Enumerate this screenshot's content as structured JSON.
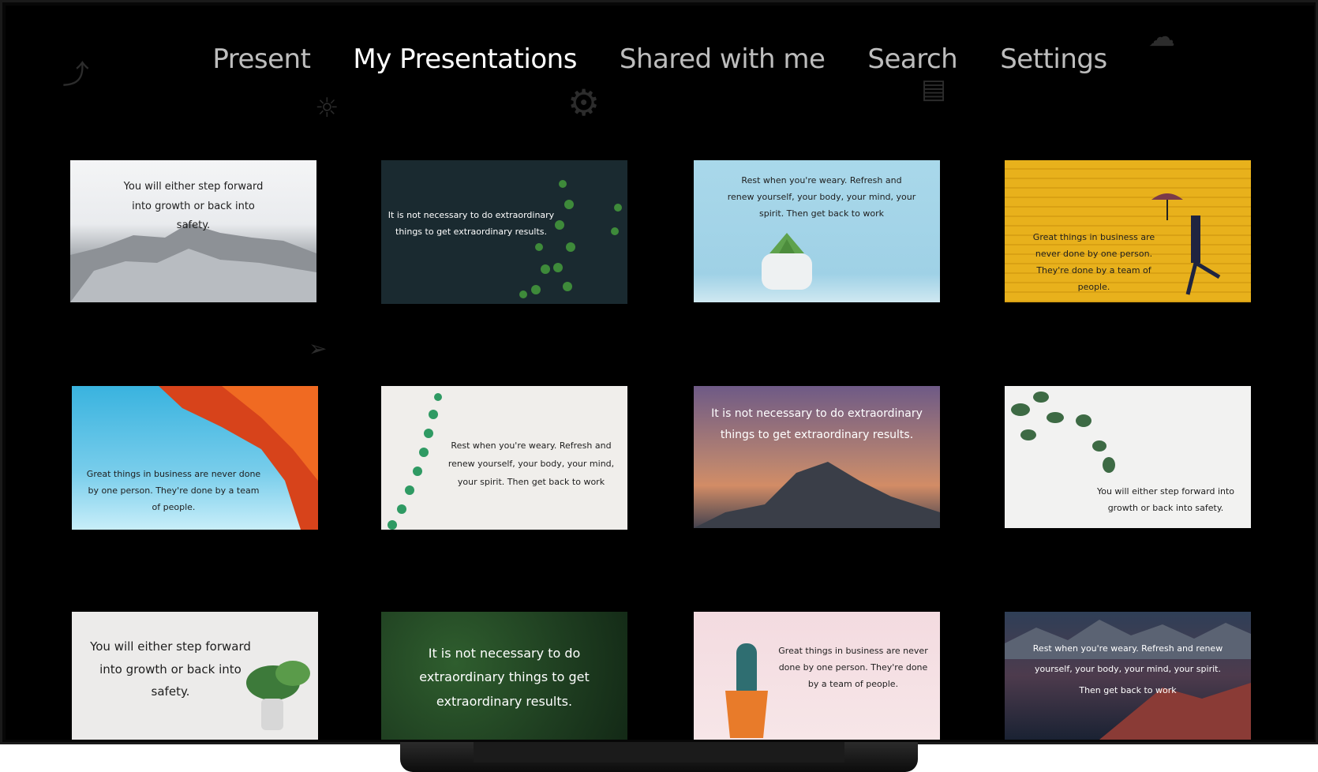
{
  "nav": {
    "tabs": [
      {
        "label": "Present"
      },
      {
        "label": "My Presentations",
        "active": true
      },
      {
        "label": "Shared with me"
      },
      {
        "label": "Search"
      },
      {
        "label": "Settings"
      }
    ]
  },
  "slides": [
    {
      "quote": "You will either step forward into growth or back into safety."
    },
    {
      "quote": "It is not necessary to do extraordinary things to get extraordinary results."
    },
    {
      "quote": "Rest when you're weary. Refresh and renew yourself, your body, your mind, your spirit. Then get back to work"
    },
    {
      "quote": "Great things in business are never done by one person. They're done by a team of people."
    },
    {
      "quote": "Great things in business are never done by one person. They're done by a team of people."
    },
    {
      "quote": "Rest when you're weary. Refresh and renew yourself, your body, your mind, your spirit. Then get back to work"
    },
    {
      "quote": "It is not necessary to do extraordinary things to get extraordinary results."
    },
    {
      "quote": "You will either step forward into growth or back into safety."
    },
    {
      "quote": "You will either step forward into growth or back into safety."
    },
    {
      "quote": "It is not necessary to do extraordinary things to get extraordinary results."
    },
    {
      "quote": "Great things in business are never done by one person. They're done by a team of people."
    },
    {
      "quote": "Rest when you're weary. Refresh and renew yourself, your body, your mind, your spirit. Then get back to work"
    }
  ],
  "icons": {
    "background": [
      "chart-icon",
      "lightbulb-icon",
      "gear-icon",
      "documents-icon",
      "cloud-icon",
      "paper-plane-icon"
    ]
  },
  "colors": {
    "background": "#000000",
    "active_tab": "#ffffff",
    "inactive_tab": "#bdbdbd"
  }
}
